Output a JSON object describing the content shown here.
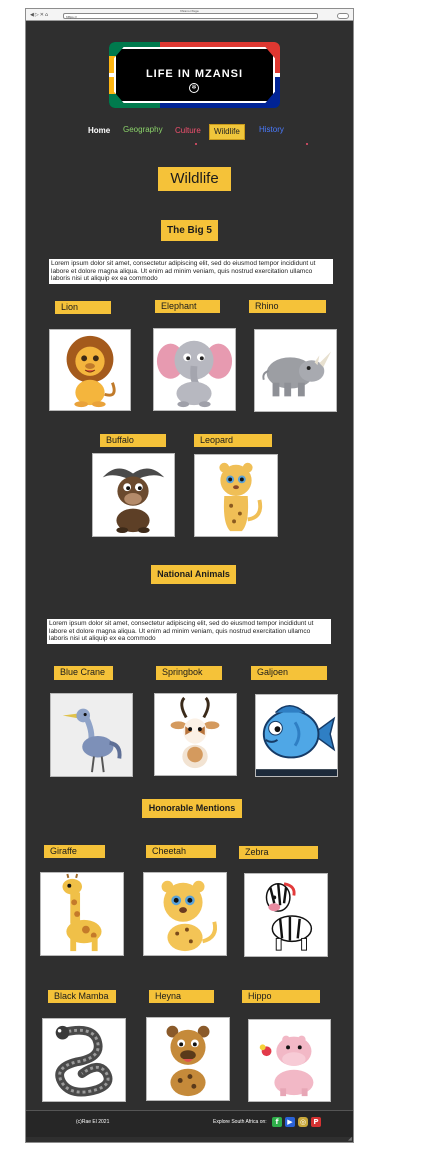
{
  "browser": {
    "title": "Mzansi Page",
    "url": "https://",
    "nav_glyphs": "◀▷✕⌂"
  },
  "logo": {
    "text": "LIFE IN MZANSI"
  },
  "nav": {
    "home": "Home",
    "geography": "Geography",
    "culture": "Culture",
    "wildlife": "Wildlife",
    "history": "History"
  },
  "page_title": "Wildlife",
  "sections": {
    "big5": "The Big 5",
    "national": "National Animals",
    "honorable": "Honorable Mentions"
  },
  "lorem": "Lorem ipsum dolor sit amet, consectetur adipiscing elit, sed do eiusmod tempor incididunt ut labore et dolore magna aliqua. Ut enim ad minim veniam, quis nostrud exercitation ullamco laboris nisi ut aliquip ex ea commodo",
  "animals": {
    "lion": "Lion",
    "elephant": "Elephant",
    "rhino": "Rhino",
    "buffalo": "Buffalo",
    "leopard": "Leopard",
    "blue_crane": "Blue Crane",
    "springbok": "Springbok",
    "galjoen": "Galjoen",
    "giraffe": "Giraffe",
    "cheetah": "Cheetah",
    "zebra": "Zebra",
    "black_mamba": "Black Mamba",
    "heyna": "Heyna",
    "hippo": "Hippo"
  },
  "footer": {
    "copyright": "(c)Rae El 2021",
    "explore": "Explore South Africa on:",
    "social_icons": [
      "facebook-icon",
      "youtube-icon",
      "instagram-icon",
      "pinterest-icon"
    ]
  },
  "colors": {
    "background": "#2f2f2f",
    "tag": "#f5c239",
    "nav_home": "#ffffff",
    "nav_geography": "#8bd36a",
    "nav_culture": "#f0506e",
    "nav_history": "#4a7bff"
  }
}
